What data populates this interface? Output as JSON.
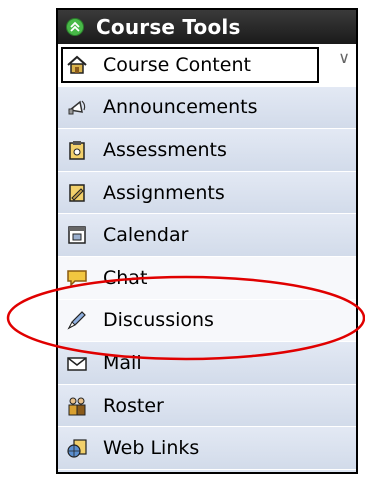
{
  "panel": {
    "title": "Course Tools",
    "collapse_icon": "chevron-up-double-icon"
  },
  "menu": {
    "items": [
      {
        "label": "Course Content",
        "icon": "home-icon",
        "selected": true
      },
      {
        "label": "Announcements",
        "icon": "megaphone-icon"
      },
      {
        "label": "Assessments",
        "icon": "clipboard-icon"
      },
      {
        "label": "Assignments",
        "icon": "pencil-paper-icon"
      },
      {
        "label": "Calendar",
        "icon": "calendar-icon"
      },
      {
        "label": "Chat",
        "icon": "speech-bubble-icon"
      },
      {
        "label": "Discussions",
        "icon": "pen-icon"
      },
      {
        "label": "Mail",
        "icon": "envelope-icon"
      },
      {
        "label": "Roster",
        "icon": "people-icon"
      },
      {
        "label": "Web Links",
        "icon": "globe-link-icon"
      }
    ]
  },
  "colors": {
    "annotation_circle": "#e00000",
    "header_bg": "#1f1f1f",
    "menu_bg": "#dbe3f0"
  },
  "chevron_glyph": "∨"
}
